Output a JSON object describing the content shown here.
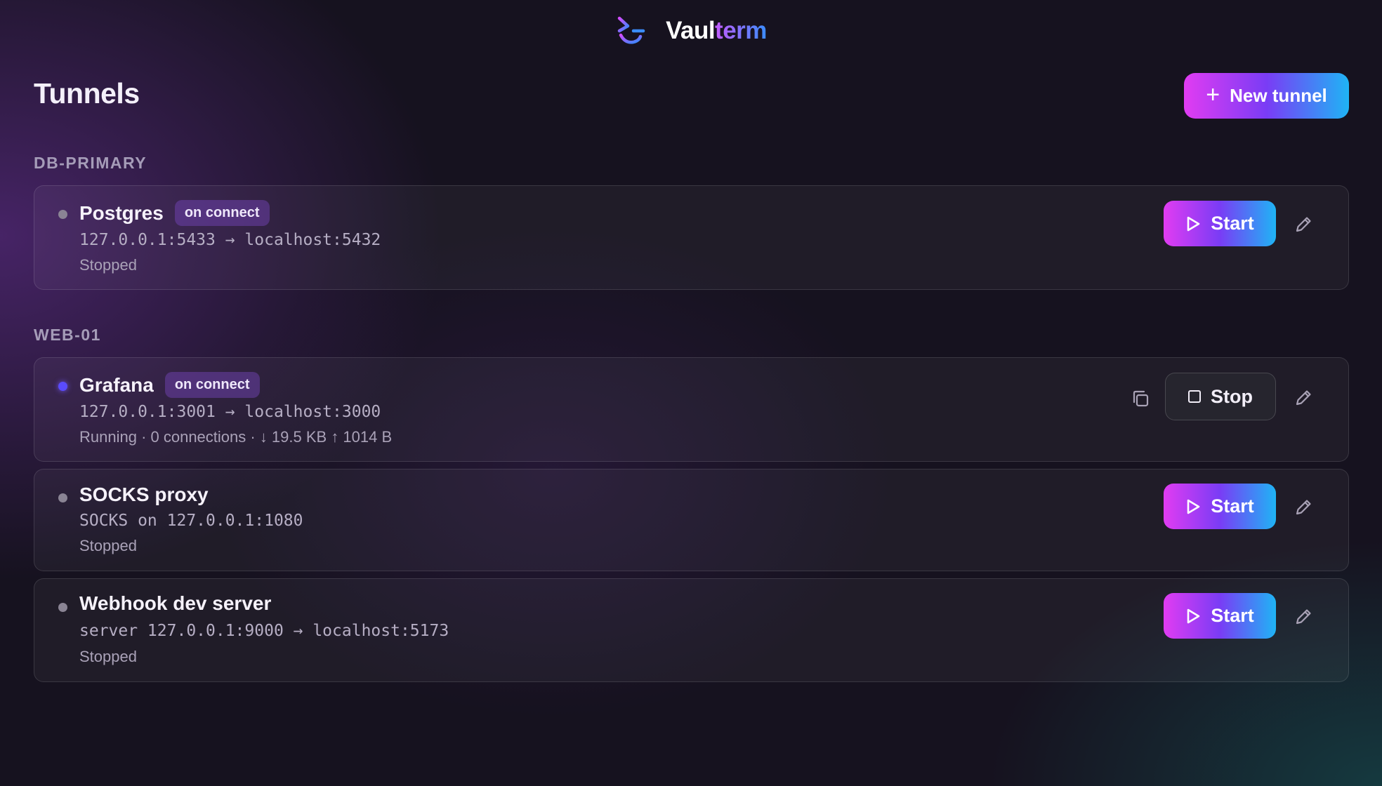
{
  "brand": {
    "name_part1": "Vaul",
    "name_part2": "term"
  },
  "page": {
    "title": "Tunnels"
  },
  "toolbar": {
    "new_tunnel_label": "New tunnel"
  },
  "groups": [
    {
      "label": "DB-PRIMARY",
      "tunnels": [
        {
          "name": "Postgres",
          "badge": "on connect",
          "address": "127.0.0.1:5433 → localhost:5432",
          "status": "Stopped",
          "action": "Start"
        }
      ]
    },
    {
      "label": "WEB-01",
      "tunnels": [
        {
          "name": "Grafana",
          "badge": "on connect",
          "address": "127.0.0.1:3001 → localhost:3000",
          "status": "Running · 0 connections · ↓ 19.5 KB ↑ 1014 B",
          "action": "Stop"
        },
        {
          "name": "SOCKS proxy",
          "address": "SOCKS on 127.0.0.1:1080",
          "status": "Stopped",
          "action": "Start"
        },
        {
          "name": "Webhook dev server",
          "address": "server 127.0.0.1:9000 → localhost:5173",
          "status": "Stopped",
          "action": "Start"
        }
      ]
    }
  ],
  "icons": {
    "logo": "vaulterm-logo-icon",
    "plus": "plus-icon",
    "play": "play-icon",
    "stop": "stop-icon",
    "edit": "pencil-icon",
    "copy": "copy-icon"
  },
  "colors": {
    "accent_gradient_start": "#e13cf2",
    "accent_gradient_mid": "#7a3cf5",
    "accent_gradient_end": "#1fb4f5",
    "running_dot": "#5a4bff",
    "stopped_dot": "#8a8494"
  }
}
